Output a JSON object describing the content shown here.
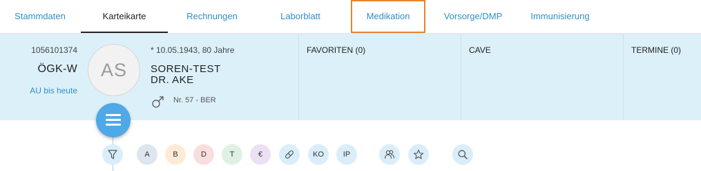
{
  "tabs": [
    {
      "label": "Stammdaten"
    },
    {
      "label": "Karteikarte"
    },
    {
      "label": "Rechnungen"
    },
    {
      "label": "Laborblatt"
    },
    {
      "label": "Medikation"
    },
    {
      "label": "Vorsorge/DMP"
    },
    {
      "label": "Immunisierung"
    }
  ],
  "active_tab": "Karteikarte",
  "highlighted_tab": "Medikation",
  "patient": {
    "number": "1056101374",
    "insurance": "ÖGK-W",
    "au_link": "AU bis heute",
    "initials": "AS",
    "birth": "* 10.05.1943, 80 Jahre",
    "last_name": "SOREN-TEST",
    "first_name": "DR. AKE",
    "gender_icon": "male-icon",
    "room": "Nr. 57 - BER"
  },
  "sections": {
    "favoriten": "FAVORITEN (0)",
    "cave": "CAVE",
    "termine": "TERMINE (0)"
  },
  "filters": {
    "a": "A",
    "b": "B",
    "d": "D",
    "t": "T",
    "euro": "€",
    "ko": "KO",
    "ip": "IP"
  },
  "colors": {
    "accent": "#2f8fc9",
    "panel_bg": "#dcf0fa",
    "highlight_border": "#e8832a",
    "fab": "#4fa8e8"
  }
}
